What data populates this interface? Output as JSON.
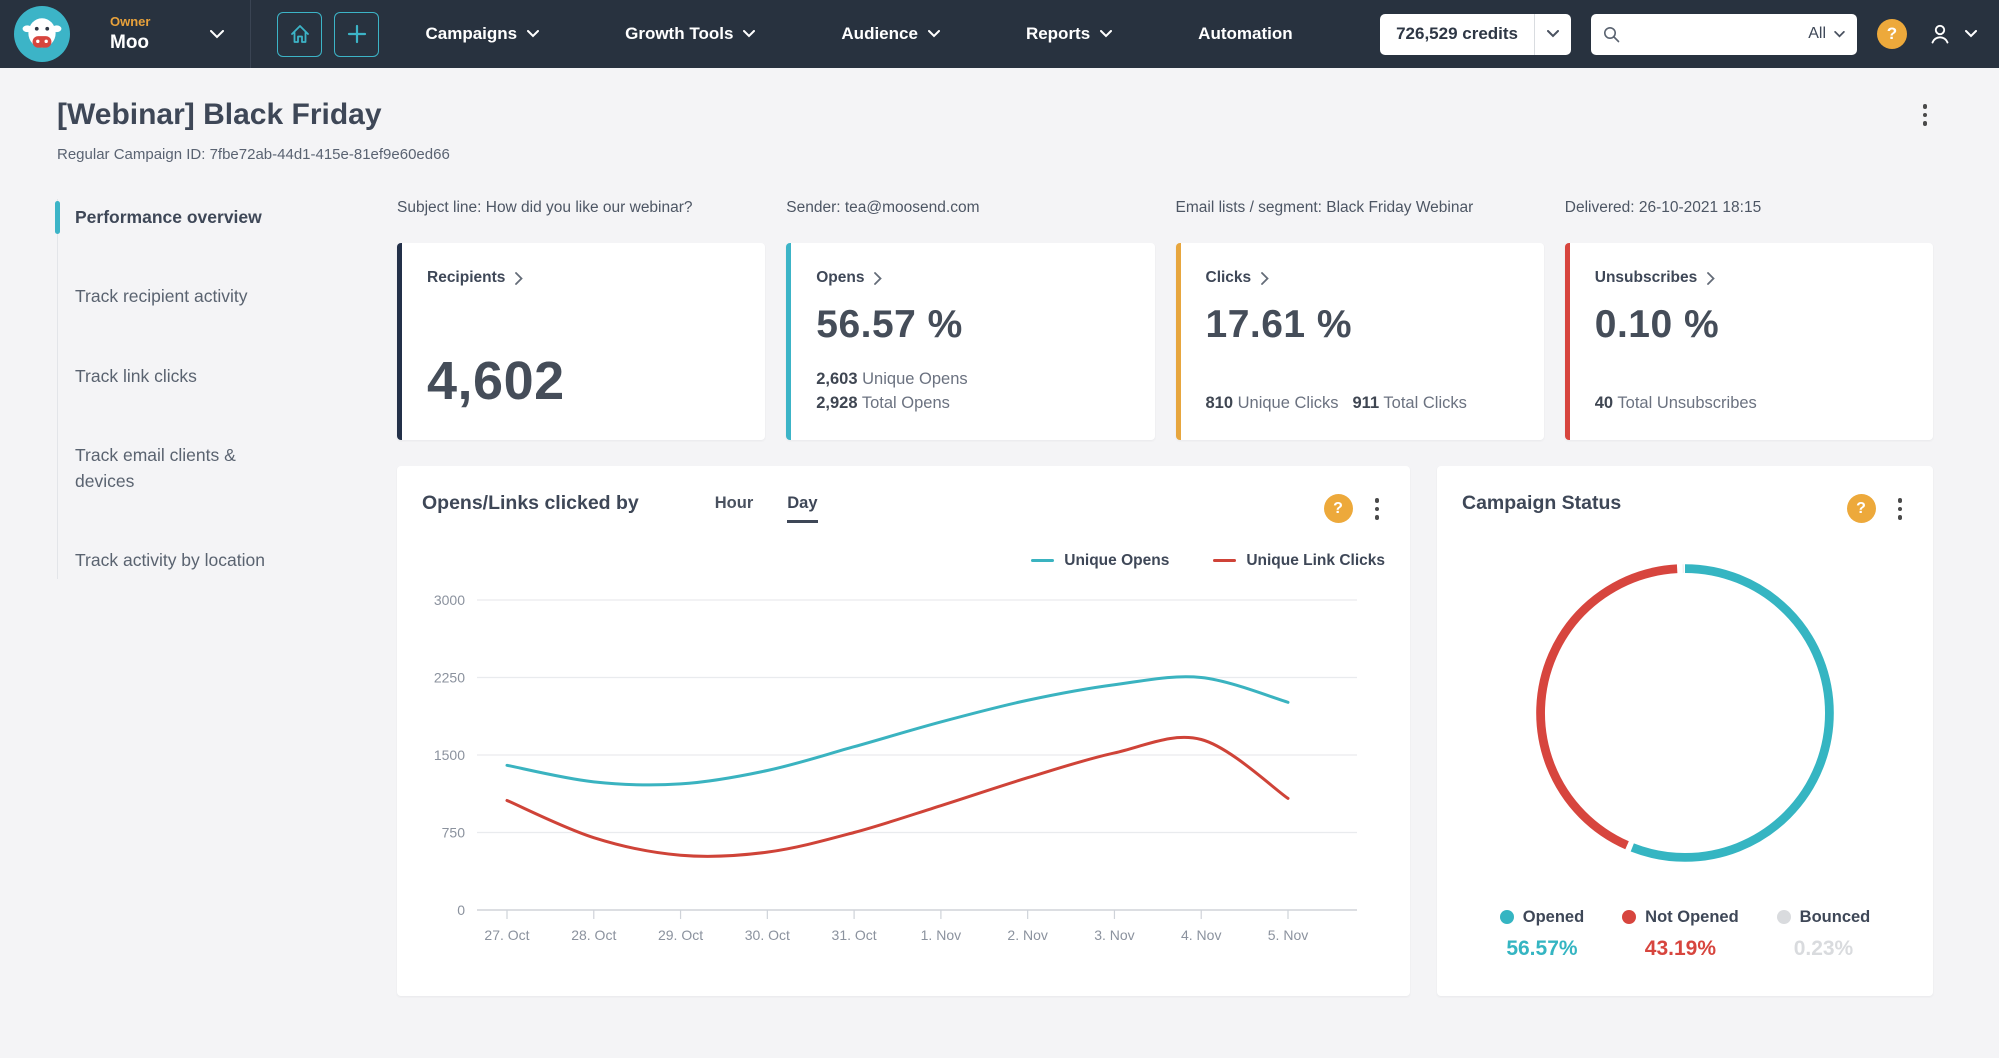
{
  "colors": {
    "teal": "#3cb4c7",
    "red": "#d7453e",
    "yellow": "#e7a63e",
    "navy": "#233049",
    "gray_slice": "#d9dbde",
    "navbar_bg": "#28323f"
  },
  "navbar": {
    "account_role": "Owner",
    "account_name": "Moo",
    "menu": [
      {
        "label": "Campaigns",
        "chevron": true
      },
      {
        "label": "Growth Tools",
        "chevron": true
      },
      {
        "label": "Audience",
        "chevron": true
      },
      {
        "label": "Reports",
        "chevron": true
      },
      {
        "label": "Automation",
        "chevron": false
      }
    ],
    "credits": "726,529 credits",
    "search": {
      "value": "",
      "filter": "All"
    },
    "help_label": "?"
  },
  "page": {
    "title": "[Webinar] Black Friday",
    "campaign_id": "Regular Campaign ID: 7fbe72ab-44d1-415e-81ef9e60ed66"
  },
  "sidebar": {
    "items": [
      {
        "label": "Performance overview",
        "active": true
      },
      {
        "label": "Track recipient activity",
        "active": false
      },
      {
        "label": "Track link clicks",
        "active": false
      },
      {
        "label": "Track email clients & devices",
        "active": false
      },
      {
        "label": "Track activity by location",
        "active": false
      }
    ]
  },
  "info": {
    "subject": "Subject line: How did you like our webinar?",
    "sender": "Sender: tea@moosend.com",
    "lists": "Email lists / segment: Black Friday Webinar",
    "delivered": "Delivered: 26-10-2021 18:15"
  },
  "cards": [
    {
      "label": "Recipients",
      "value": "4,602",
      "accent": "#233049"
    },
    {
      "label": "Opens",
      "value": "56.57 %",
      "accent": "#3cb4c7",
      "detail1_num": "2,603",
      "detail1_text": "Unique Opens",
      "detail2_num": "2,928",
      "detail2_text": "Total Opens"
    },
    {
      "label": "Clicks",
      "value": "17.61 %",
      "accent": "#e7a63e",
      "detail1_num": "810",
      "detail1_text": "Unique Clicks",
      "detail2_num": "911",
      "detail2_text": "Total Clicks"
    },
    {
      "label": "Unsubscribes",
      "value": "0.10 %",
      "accent": "#d7453e",
      "detail1_num": "40",
      "detail1_text": "Total Unsubscribes"
    }
  ],
  "chart_data": [
    {
      "type": "line",
      "title": "Opens/Links clicked by",
      "tabs": [
        "Hour",
        "Day"
      ],
      "active_tab": "Day",
      "categories": [
        "27. Oct",
        "28. Oct",
        "29. Oct",
        "30. Oct",
        "31. Oct",
        "1. Nov",
        "2. Nov",
        "3. Nov",
        "4. Nov",
        "5. Nov"
      ],
      "series": [
        {
          "name": "Unique Opens",
          "color": "#3ab3c0",
          "values": [
            1400,
            1240,
            1220,
            1350,
            1580,
            1820,
            2030,
            2180,
            2250,
            2010
          ]
        },
        {
          "name": "Unique Link Clicks",
          "color": "#cf4338",
          "values": [
            1060,
            700,
            530,
            560,
            750,
            1010,
            1280,
            1520,
            1650,
            1080
          ]
        }
      ],
      "ylim": [
        0,
        3000
      ],
      "y_ticks": [
        0,
        750,
        1500,
        2250,
        3000
      ],
      "grid": true,
      "legend_position": "top-right"
    },
    {
      "type": "donut",
      "title": "Campaign Status",
      "slices": [
        {
          "label": "Opened",
          "value": 56.57,
          "display": "56.57%",
          "color": "#35b5c2"
        },
        {
          "label": "Not Opened",
          "value": 43.19,
          "display": "43.19%",
          "color": "#d7453e"
        },
        {
          "label": "Bounced",
          "value": 0.23,
          "display": "0.23%",
          "color": "#d9dbde"
        }
      ]
    }
  ]
}
